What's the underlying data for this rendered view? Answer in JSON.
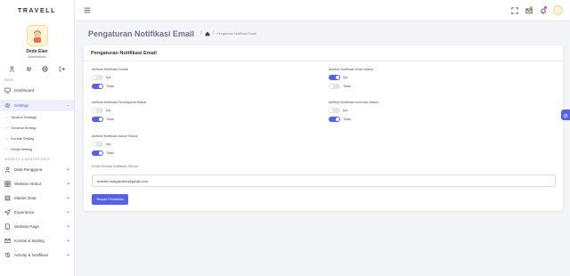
{
  "brand": "TRAVELL",
  "profile": {
    "name": "Dede Elan",
    "role": "Administrator"
  },
  "sidebar": {
    "section_main": "MAIN",
    "dashboard": "Dashboard",
    "settings": "Settings",
    "settings_sub": [
      "Section Settings",
      "General Setting",
      "Kontak Setting",
      "Email Setting"
    ],
    "section_master": "WEBSITE & MASTER DATA",
    "items": [
      "Data Pengguna",
      "Website Atribut",
      "Master Data",
      "Experience",
      "Website Page",
      "Kontak & Mailing",
      "Activity & Notifikasi"
    ],
    "expand_symbol": "+",
    "collapse_symbol": "−",
    "chevron": "›"
  },
  "header": {
    "title": "Pengaturan Notifikasi Email",
    "sep": "/",
    "breadcrumb": "Pengaturan Notifikasi Email"
  },
  "card": {
    "title": "Pengaturan Notifikasi Email",
    "groups": [
      {
        "label": "Aktifkan Notifikasi Kontak",
        "iya": "Iya",
        "tidak": "Tidak",
        "selected": "tidak"
      },
      {
        "label": "Aktifkan Notifikasi Order Masuk",
        "iya": "Iya",
        "tidak": "Tidak",
        "selected": "iya"
      },
      {
        "label": "Aktifkan Notifikasi Pembayaran Masuk",
        "iya": "Iya",
        "tidak": "Tidak",
        "selected": "tidak"
      },
      {
        "label": "Aktifkan Notifikasi komentar Masuk",
        "iya": "Iya",
        "tidak": "Tidak",
        "selected": "tidak"
      },
      {
        "label": "Aktifkan Notifikasi ulasan Masuk",
        "iya": "Iya",
        "tidak": "Tidak",
        "selected": "tidak"
      }
    ],
    "email_label": "Email Tempat Notifikasi Dikirim",
    "email_value": "mdede.hidayatullah@gmail.com",
    "save_label": "Simpan Perubahan"
  },
  "colors": {
    "accent": "#5561e8",
    "notif_dot_mail": "#f0ad4e",
    "notif_dot_bell": "#e84a5f"
  }
}
